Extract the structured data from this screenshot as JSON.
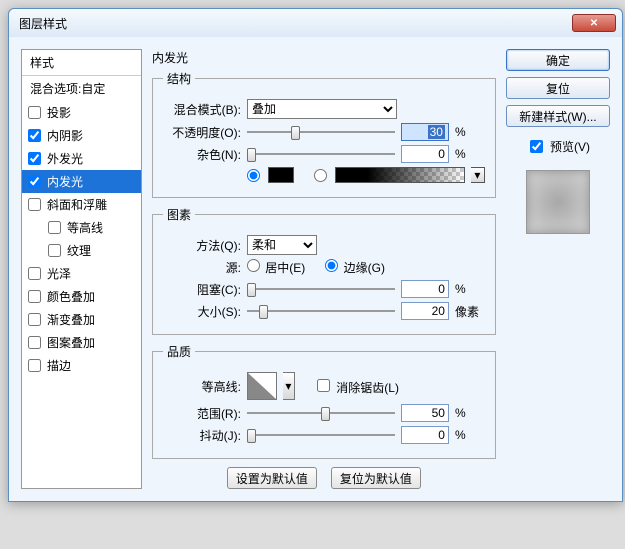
{
  "title": "图层样式",
  "styles": {
    "header": "样式",
    "blend_header": "混合选项:自定",
    "items": [
      {
        "label": "投影",
        "checked": false,
        "indent": false
      },
      {
        "label": "内阴影",
        "checked": true,
        "indent": false
      },
      {
        "label": "外发光",
        "checked": true,
        "indent": false
      },
      {
        "label": "内发光",
        "checked": true,
        "indent": false,
        "selected": true
      },
      {
        "label": "斜面和浮雕",
        "checked": false,
        "indent": false
      },
      {
        "label": "等高线",
        "checked": false,
        "indent": true
      },
      {
        "label": "纹理",
        "checked": false,
        "indent": true
      },
      {
        "label": "光泽",
        "checked": false,
        "indent": false
      },
      {
        "label": "颜色叠加",
        "checked": false,
        "indent": false
      },
      {
        "label": "渐变叠加",
        "checked": false,
        "indent": false
      },
      {
        "label": "图案叠加",
        "checked": false,
        "indent": false
      },
      {
        "label": "描边",
        "checked": false,
        "indent": false
      }
    ]
  },
  "panel_title": "内发光",
  "structure": {
    "legend": "结构",
    "blend_mode_label": "混合模式(B):",
    "blend_mode_value": "叠加",
    "opacity_label": "不透明度(O):",
    "opacity_value": "30",
    "opacity_unit": "%",
    "noise_label": "杂色(N):",
    "noise_value": "0",
    "noise_unit": "%",
    "color_swatch": "#000000"
  },
  "elements": {
    "legend": "图素",
    "technique_label": "方法(Q):",
    "technique_value": "柔和",
    "source_label": "源:",
    "source_center": "居中(E)",
    "source_edge": "边缘(G)",
    "source_selected": "edge",
    "choke_label": "阻塞(C):",
    "choke_value": "0",
    "choke_unit": "%",
    "size_label": "大小(S):",
    "size_value": "20",
    "size_unit": "像素"
  },
  "quality": {
    "legend": "品质",
    "contour_label": "等高线:",
    "antialias_label": "消除锯齿(L)",
    "antialias_checked": false,
    "range_label": "范围(R):",
    "range_value": "50",
    "range_unit": "%",
    "jitter_label": "抖动(J):",
    "jitter_value": "0",
    "jitter_unit": "%"
  },
  "footer": {
    "make_default": "设置为默认值",
    "reset_default": "复位为默认值"
  },
  "side": {
    "ok": "确定",
    "cancel": "复位",
    "new_style": "新建样式(W)...",
    "preview": "预览(V)",
    "preview_checked": true
  }
}
